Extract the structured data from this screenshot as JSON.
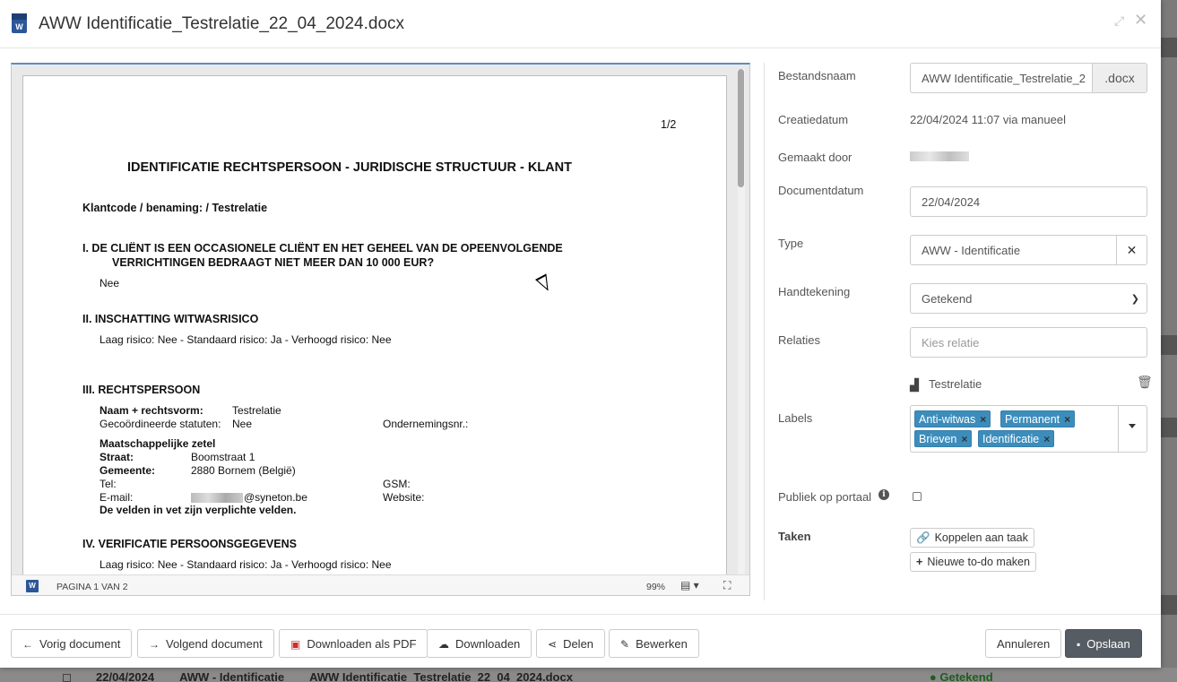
{
  "window": {
    "title": "AWW Identificatie_Testrelatie_22_04_2024.docx",
    "doc_icon": "word-icon",
    "expand_icon": "expand-icon",
    "close_icon": "close-icon"
  },
  "document": {
    "page_indicator": "1/2",
    "heading": "IDENTIFICATIE RECHTSPERSOON - JURIDISCHE STRUCTUUR - KLANT",
    "klantcode": "Klantcode / benaming:  / Testrelatie",
    "section1_line1": "I. DE CLIËNT IS EEN OCCASIONELE CLIËNT EN HET GEHEEL VAN DE OPEENVOLGENDE",
    "section1_line2": "VERRICHTINGEN BEDRAAGT NIET MEER DAN 10 000 EUR?",
    "section1_answer": "Nee",
    "section2_title": "II. INSCHATTING WITWASRISICO",
    "section2_text": "Laag risico: Nee - Standaard risico: Ja - Verhoogd risico: Nee",
    "section3_title": "III. RECHTSPERSOON",
    "naam_label": "Naam + rechtsvorm:",
    "naam_value": "Testrelatie",
    "statuten_label": "Gecoördineerde statuten:",
    "statuten_value": "Nee",
    "ondernemingsnr_label": "Ondernemingsnr.:",
    "zetel_title": "Maatschappelijke zetel",
    "straat_label": "Straat:",
    "straat_value": "Boomstraat 1",
    "gemeente_label": "Gemeente:",
    "gemeente_value": "2880 Bornem (België)",
    "tel_label": "Tel:",
    "gsm_label": "GSM:",
    "email_label": "E-mail:",
    "email_suffix": "@syneton.be",
    "website_label": "Website:",
    "required_note": "De velden in vet zijn verplichte velden.",
    "section4_title": "IV. VERIFICATIE PERSOONSGEGEVENS",
    "section4_text": "Laag risico: Nee - Standaard risico: Ja - Verhoogd risico: Nee"
  },
  "viewer_status": {
    "page_text": "PAGINA 1 VAN 2",
    "zoom": "99%",
    "view_icon": "page-view-icon",
    "fit_icon": "fit-screen-icon"
  },
  "form": {
    "bestandsnaam_label": "Bestandsnaam",
    "bestandsnaam_value": "AWW Identificatie_Testrelatie_2",
    "extension": ".docx",
    "creatiedatum_label": "Creatiedatum",
    "creatiedatum_value": "22/04/2024 11:07 via manueel",
    "gemaakt_door_label": "Gemaakt door",
    "documentdatum_label": "Documentdatum",
    "documentdatum_value": "22/04/2024",
    "type_label": "Type",
    "type_value": "AWW -  Identificatie",
    "handtekening_label": "Handtekening",
    "handtekening_value": "Getekend",
    "relaties_label": "Relaties",
    "relaties_placeholder": "Kies relatie",
    "relation_name": "Testrelatie",
    "labels_label": "Labels",
    "labels": [
      "Anti-witwas",
      "Permanent",
      "Brieven",
      "Identificatie"
    ],
    "publiek_label": "Publiek op portaal",
    "taken_label": "Taken",
    "koppelen_label": "Koppelen aan taak",
    "nieuwe_todo_label": "Nieuwe to-do maken"
  },
  "footer": {
    "vorig": "Vorig document",
    "volgend": "Volgend document",
    "download_pdf": "Downloaden als PDF",
    "download": "Downloaden",
    "delen": "Delen",
    "bewerken": "Bewerken",
    "annuleren": "Annuleren",
    "opslaan": "Opslaan"
  },
  "background_row": {
    "date": "22/04/2024",
    "type": "AWW - Identificatie",
    "filename": "AWW Identificatie_Testrelatie_22_04_2024.docx",
    "status": "Getekend"
  },
  "colors": {
    "tag_blue": "#3c8dbc",
    "primary_button": "#555c63",
    "word_blue": "#2b579a",
    "pdf_red": "#c9302c"
  }
}
